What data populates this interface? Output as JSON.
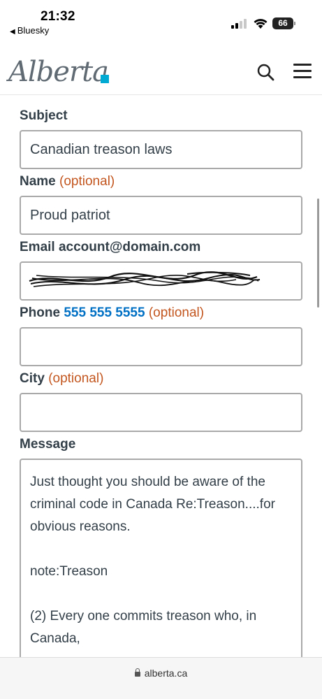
{
  "status_bar": {
    "time": "21:32",
    "back_app": "Bluesky",
    "battery": "66"
  },
  "header": {
    "logo_text": "Alberta",
    "icons": [
      "search-icon",
      "hamburger-menu-icon"
    ]
  },
  "form": {
    "subject": {
      "label": "Subject",
      "value": "Canadian treason laws"
    },
    "name": {
      "label": "Name",
      "optional": "(optional)",
      "value": "Proud patriot"
    },
    "email": {
      "label": "Email",
      "hint": "account@domain.com",
      "value": ""
    },
    "phone": {
      "label": "Phone",
      "hint": "555 555 5555",
      "optional": "(optional)",
      "value": ""
    },
    "city": {
      "label": "City",
      "optional": "(optional)",
      "value": ""
    },
    "message": {
      "label": "Message",
      "value": "Just thought you should be aware of the criminal code in Canada Re:Treason....for obvious reasons.\n\nnote:Treason\n\n(2) Every one commits treason who, in Canada,"
    }
  },
  "browser": {
    "url": "alberta.ca"
  },
  "colors": {
    "optional": "#c3561f",
    "phone_hint": "#0070c4",
    "logo_square": "#00aad2",
    "label": "#333f48"
  }
}
